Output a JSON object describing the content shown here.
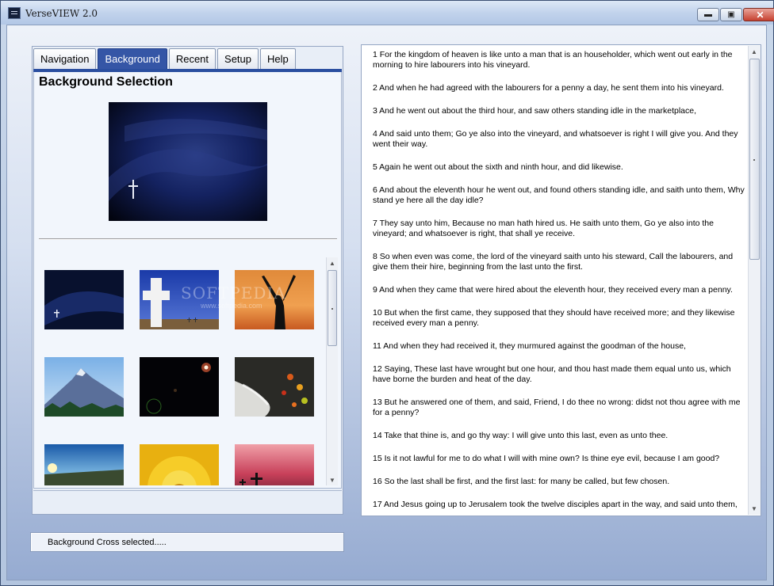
{
  "window": {
    "title": "VerseVIEW 2.0",
    "minimize": "▬",
    "maximize": "▣",
    "close": "✕"
  },
  "tabs": [
    {
      "label": "Navigation",
      "active": false
    },
    {
      "label": "Background",
      "active": true
    },
    {
      "label": "Recent",
      "active": false
    },
    {
      "label": "Setup",
      "active": false
    },
    {
      "label": "Help",
      "active": false
    }
  ],
  "background": {
    "section_title": "Background Selection",
    "thumbnails": [
      "cross-night",
      "white-cross",
      "raised-hands-sunset",
      "mountain",
      "space-flare",
      "waterfall-leaves",
      "sunrise-valley",
      "yellow-flower",
      "red-sky-crosses"
    ],
    "watermark": "SOFTPEDIA",
    "watermark_url": "www.softpedia.com"
  },
  "status": {
    "text": "Background Cross selected....."
  },
  "verses": [
    "1 For the kingdom of heaven is like unto a man that is an householder, which went out early in the morning to hire labourers into his vineyard.",
    "2 And when he had agreed with the labourers for a penny a day, he sent them into his vineyard.",
    "3 And he went out about the third hour, and saw others standing idle in the marketplace,",
    "4 And said unto them; Go ye also into the vineyard, and whatsoever is right I will give you. And they went their way.",
    "5 Again he went out about the sixth and ninth hour, and did likewise.",
    "6 And about the eleventh hour he went out, and found others standing idle, and saith unto them, Why stand ye here all the day idle?",
    "7 They say unto him, Because no man hath hired us. He saith unto them, Go ye also into the vineyard; and whatsoever is right, that shall ye receive.",
    "8 So when even was come, the lord of the vineyard saith unto his steward, Call the labourers, and give them their hire, beginning from the last unto the first.",
    "9 And when they came that were hired about the eleventh hour, they received every man a penny.",
    "10 But when the first came, they supposed that they should have received more; and they likewise received every man a penny.",
    "11 And when they had received it, they murmured against the goodman of the house,",
    "12 Saying, These last have wrought but one hour, and thou hast made them equal unto us, which have borne the burden and heat of the day.",
    "13 But he answered one of them, and said, Friend, I do thee no wrong: didst not thou agree with me for a penny?",
    "14 Take that thine is, and go thy way: I will give unto this last, even as unto thee.",
    "15 Is it not lawful for me to do what I will with mine own? Is thine eye evil, because I am good?",
    "16 So the last shall be first, and the first last: for many be called, but few chosen.",
    "17 And Jesus going up to Jerusalem took the twelve disciples apart in the way, and said unto them,"
  ]
}
